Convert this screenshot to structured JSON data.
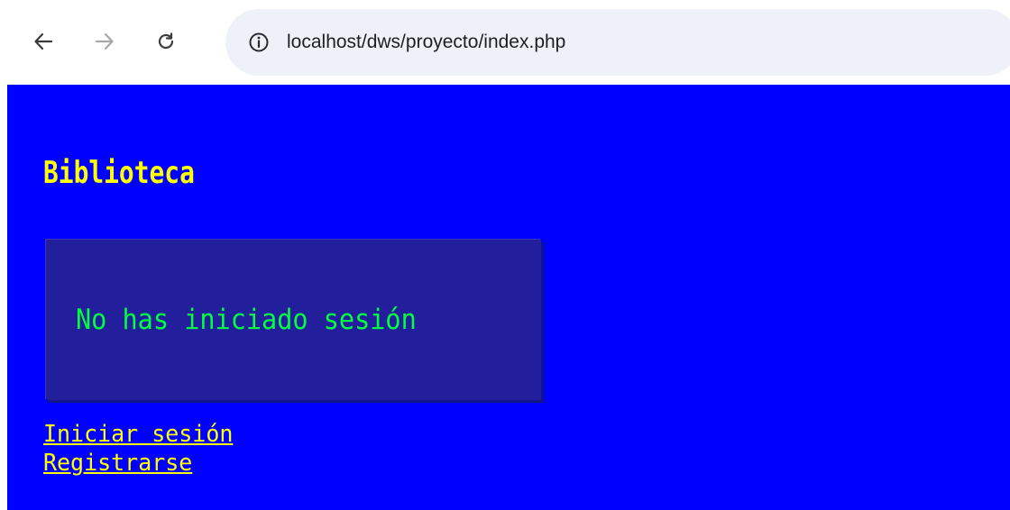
{
  "browser": {
    "url": "localhost/dws/proyecto/index.php",
    "icons": {
      "back": "arrow-left-icon",
      "forward": "arrow-right-icon",
      "reload": "reload-icon",
      "site_info": "info-icon"
    }
  },
  "page": {
    "title": "Biblioteca",
    "session_status": "No has iniciado sesión",
    "links": {
      "login": "Iniciar sesión",
      "register": "Registrarse"
    },
    "colors": {
      "background": "#0000ff",
      "title": "#ffff00",
      "box_background": "#231f9c",
      "status_text": "#00ff41",
      "link": "#ffff00"
    }
  }
}
